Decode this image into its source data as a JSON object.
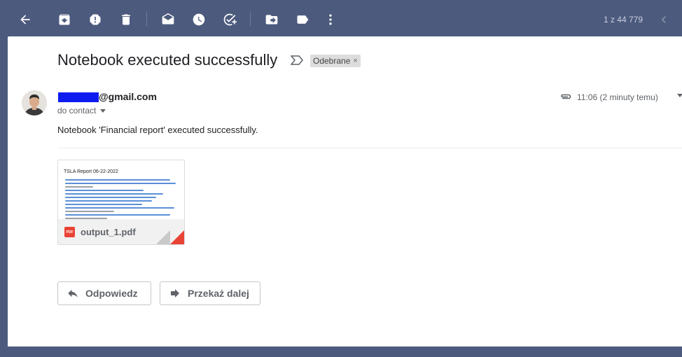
{
  "toolbar": {
    "icons": [
      "back-arrow-icon",
      "archive-icon",
      "report-spam-icon",
      "delete-icon",
      "mark-unread-icon",
      "snooze-icon",
      "add-to-tasks-icon",
      "move-to-icon",
      "labels-icon",
      "more-icon"
    ],
    "page_count": "1 z 44 779"
  },
  "message": {
    "subject": "Notebook executed successfully",
    "label": "Odebrane",
    "label_remove": "×",
    "sender": "@gmail.com",
    "recipient": "do contact",
    "time": "11:06 (2 minuty temu)",
    "body": "Notebook 'Financial report' executed successfully."
  },
  "attachment": {
    "filename": "output_1.pdf",
    "type_badge": "PDF",
    "preview_title": "TSLA Report 06-22-2022"
  },
  "actions": {
    "reply": "Odpowiedz",
    "forward": "Przekaż dalej"
  },
  "colors": {
    "toolbar_bg": "#4c5a7d",
    "pdf_red": "#e94335",
    "redaction_blue": "#0f1cf0"
  }
}
